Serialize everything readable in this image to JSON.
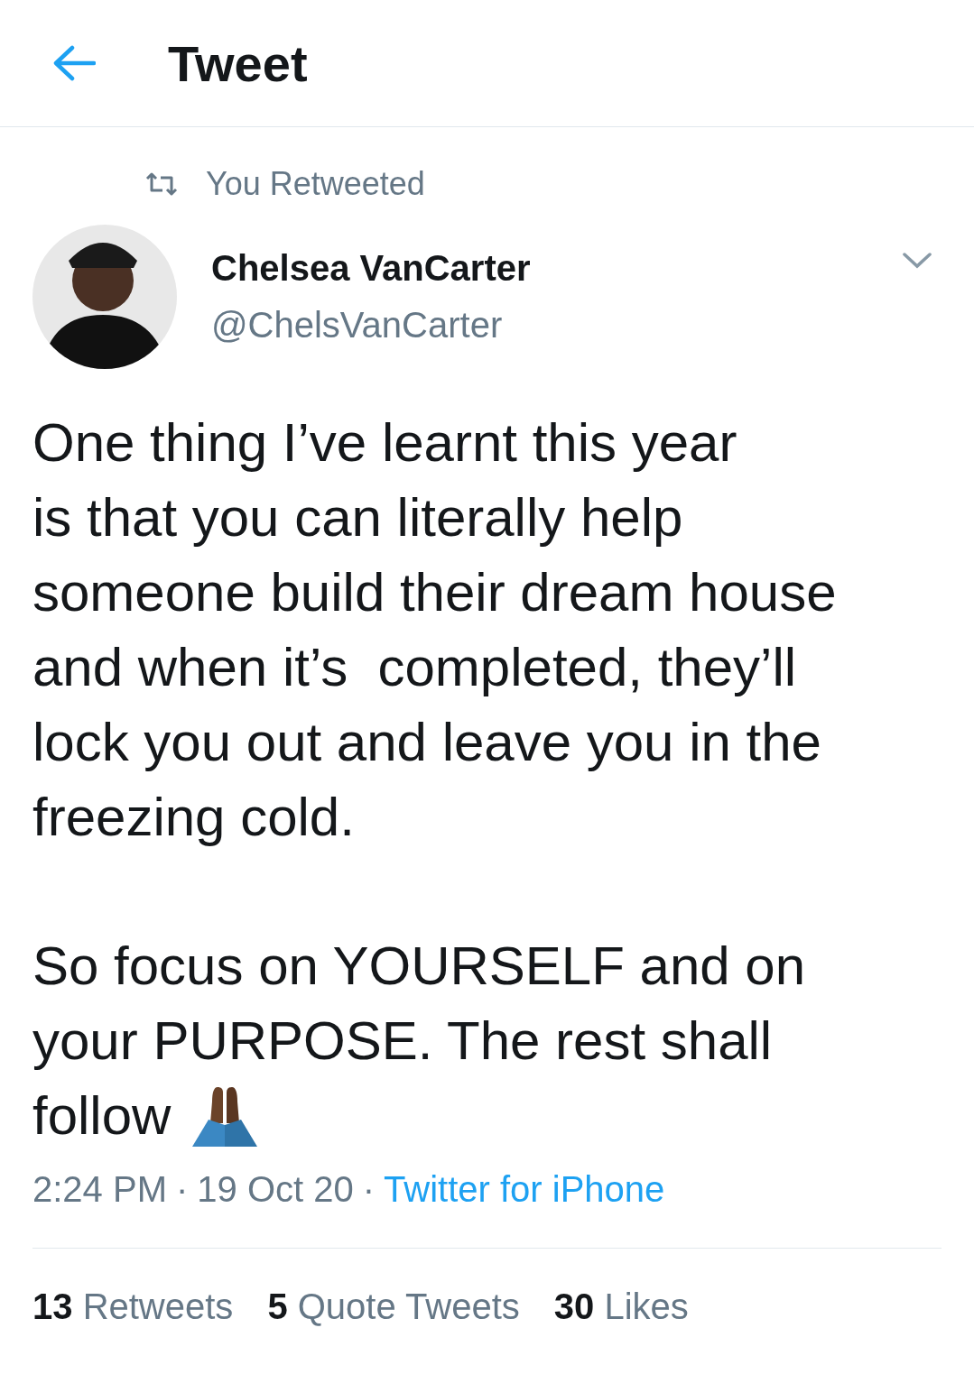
{
  "header": {
    "title": "Tweet"
  },
  "retweet_context": {
    "label": "You Retweeted"
  },
  "author": {
    "name": "Chelsea VanCarter",
    "handle": "@ChelsVanCarter"
  },
  "tweet": {
    "paragraphs": [
      {
        "lines": [
          "One thing I’ve learnt this year",
          "is that you can literally help",
          "someone build their dream house",
          "and when it’s  completed, they’ll",
          "lock you out and leave you in the",
          "freezing cold."
        ]
      },
      {
        "lines": [
          "So focus on YOURSELF and on",
          "your PURPOSE. The rest shall",
          "follow"
        ],
        "ends_with_emoji": true
      }
    ]
  },
  "meta": [
    {
      "text": "2:24 PM",
      "kind": "plain"
    },
    {
      "text": "·",
      "kind": "separator"
    },
    {
      "text": "19 Oct 20",
      "kind": "plain"
    },
    {
      "text": "·",
      "kind": "separator"
    },
    {
      "text": "Twitter for iPhone",
      "kind": "link"
    }
  ],
  "stats": [
    {
      "count": "13",
      "label": "Retweets"
    },
    {
      "count": "5",
      "label": "Quote Tweets"
    },
    {
      "count": "30",
      "label": "Likes"
    }
  ]
}
